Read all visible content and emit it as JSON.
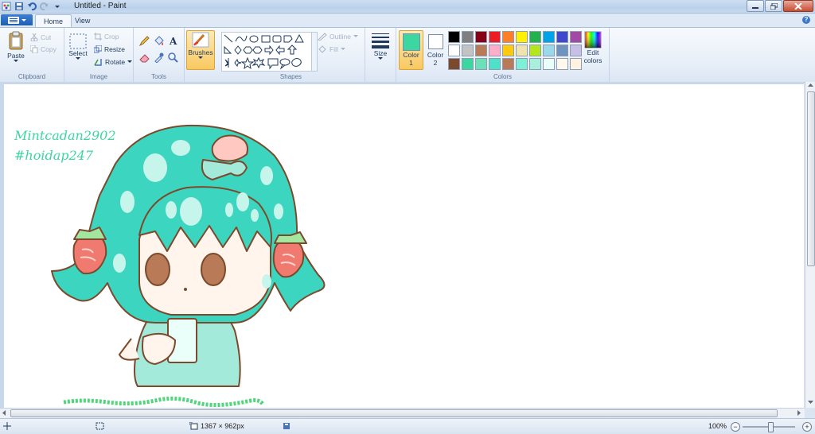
{
  "window": {
    "title": "Untitled - Paint"
  },
  "tabs": [
    {
      "label": "Home"
    },
    {
      "label": "View"
    }
  ],
  "clipboard": {
    "paste": "Paste",
    "cut": "Cut",
    "copy": "Copy",
    "label": "Clipboard"
  },
  "image": {
    "select": "Select",
    "crop": "Crop",
    "resize": "Resize",
    "rotate": "Rotate",
    "label": "Image"
  },
  "tools": {
    "label": "Tools",
    "brushes": "Brushes"
  },
  "shapes": {
    "outline": "Outline",
    "fill": "Fill",
    "label": "Shapes"
  },
  "size": {
    "label": "Size"
  },
  "colors": {
    "color1": "Color",
    "color1_num": "1",
    "color2": "Color",
    "color2_num": "2",
    "edit": "Edit",
    "edit2": "colors",
    "label": "Colors",
    "color1_value": "#3cd6a0",
    "color2_value": "#ffffff",
    "swatches": [
      "#000000",
      "#7f7f7f",
      "#880015",
      "#ed1c24",
      "#ff7f27",
      "#fff200",
      "#22b14c",
      "#00a2e8",
      "#3f48cc",
      "#a349a4",
      "#ffffff",
      "#c3c3c3",
      "#b97a57",
      "#ffaec9",
      "#ffc90e",
      "#efe4b0",
      "#b5e61d",
      "#99d9ea",
      "#7092be",
      "#c8bfe7",
      "#7b4a2c",
      "#3cd6a0",
      "#6ee0b8",
      "#4fe0c8",
      "#b97a57",
      "#7ff0d8",
      "#a9f0dc",
      "#eafffa",
      "#fff8ee",
      "#fff2e0"
    ]
  },
  "canvas": {
    "watermark_line1": "Mintcadan2902",
    "watermark_line2": "#hoidap247",
    "hair_color": "#3cd6c0",
    "outline_color": "#7b4a2c"
  },
  "status": {
    "dimensions": "1367 × 962px",
    "zoom": "100%"
  }
}
